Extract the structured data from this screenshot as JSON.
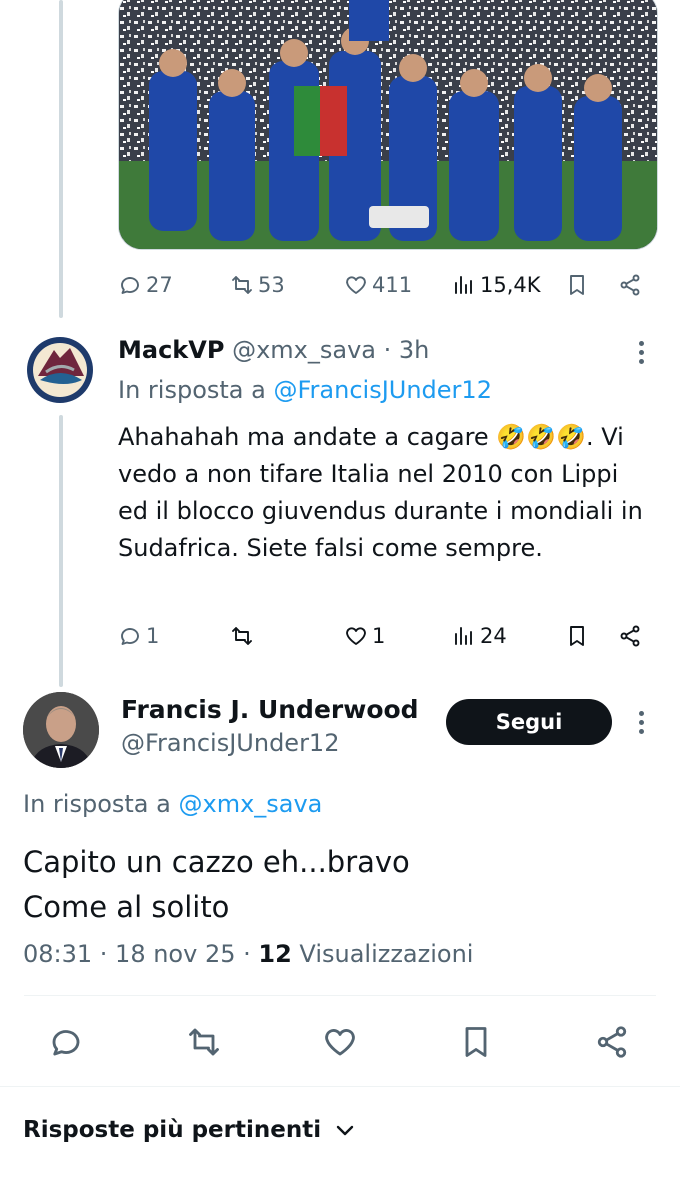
{
  "first_tweet": {
    "actions": {
      "replies": "27",
      "retweets": "53",
      "likes": "411",
      "views": "15,4K"
    }
  },
  "reply_tweet": {
    "display_name": "MackVP",
    "handle": "@xmx_sava",
    "time": "· 3h",
    "reply_prefix": "In risposta a",
    "reply_to": "@FrancisJUnder12",
    "text": "Ahahahah ma andate a cagare 🤣🤣🤣. Vi vedo a non tifare Italia nel 2010 con Lippi ed il blocco giuvendus durante i mondiali in Sudafrica. Siete falsi come sempre.",
    "actions": {
      "replies": "1",
      "retweets": "",
      "likes": "1",
      "views": "24"
    }
  },
  "main_tweet": {
    "display_name": "Francis J. Underwood",
    "handle": "@FrancisJUnder12",
    "follow_label": "Segui",
    "reply_prefix": "In risposta a",
    "reply_to": "@xmx_sava",
    "text_line1": "Capito un cazzo eh...bravo",
    "text_line2": "Come al solito",
    "time": "08:31 · 18 nov 25 · ",
    "views_count": "12",
    "views_label": "Visualizzazioni"
  },
  "sort_bar": {
    "label": "Risposte più pertinenti"
  },
  "colors": {
    "text": "#0f1419",
    "muted": "#536471",
    "link": "#1d9bf0",
    "divider": "#eff3f4"
  }
}
